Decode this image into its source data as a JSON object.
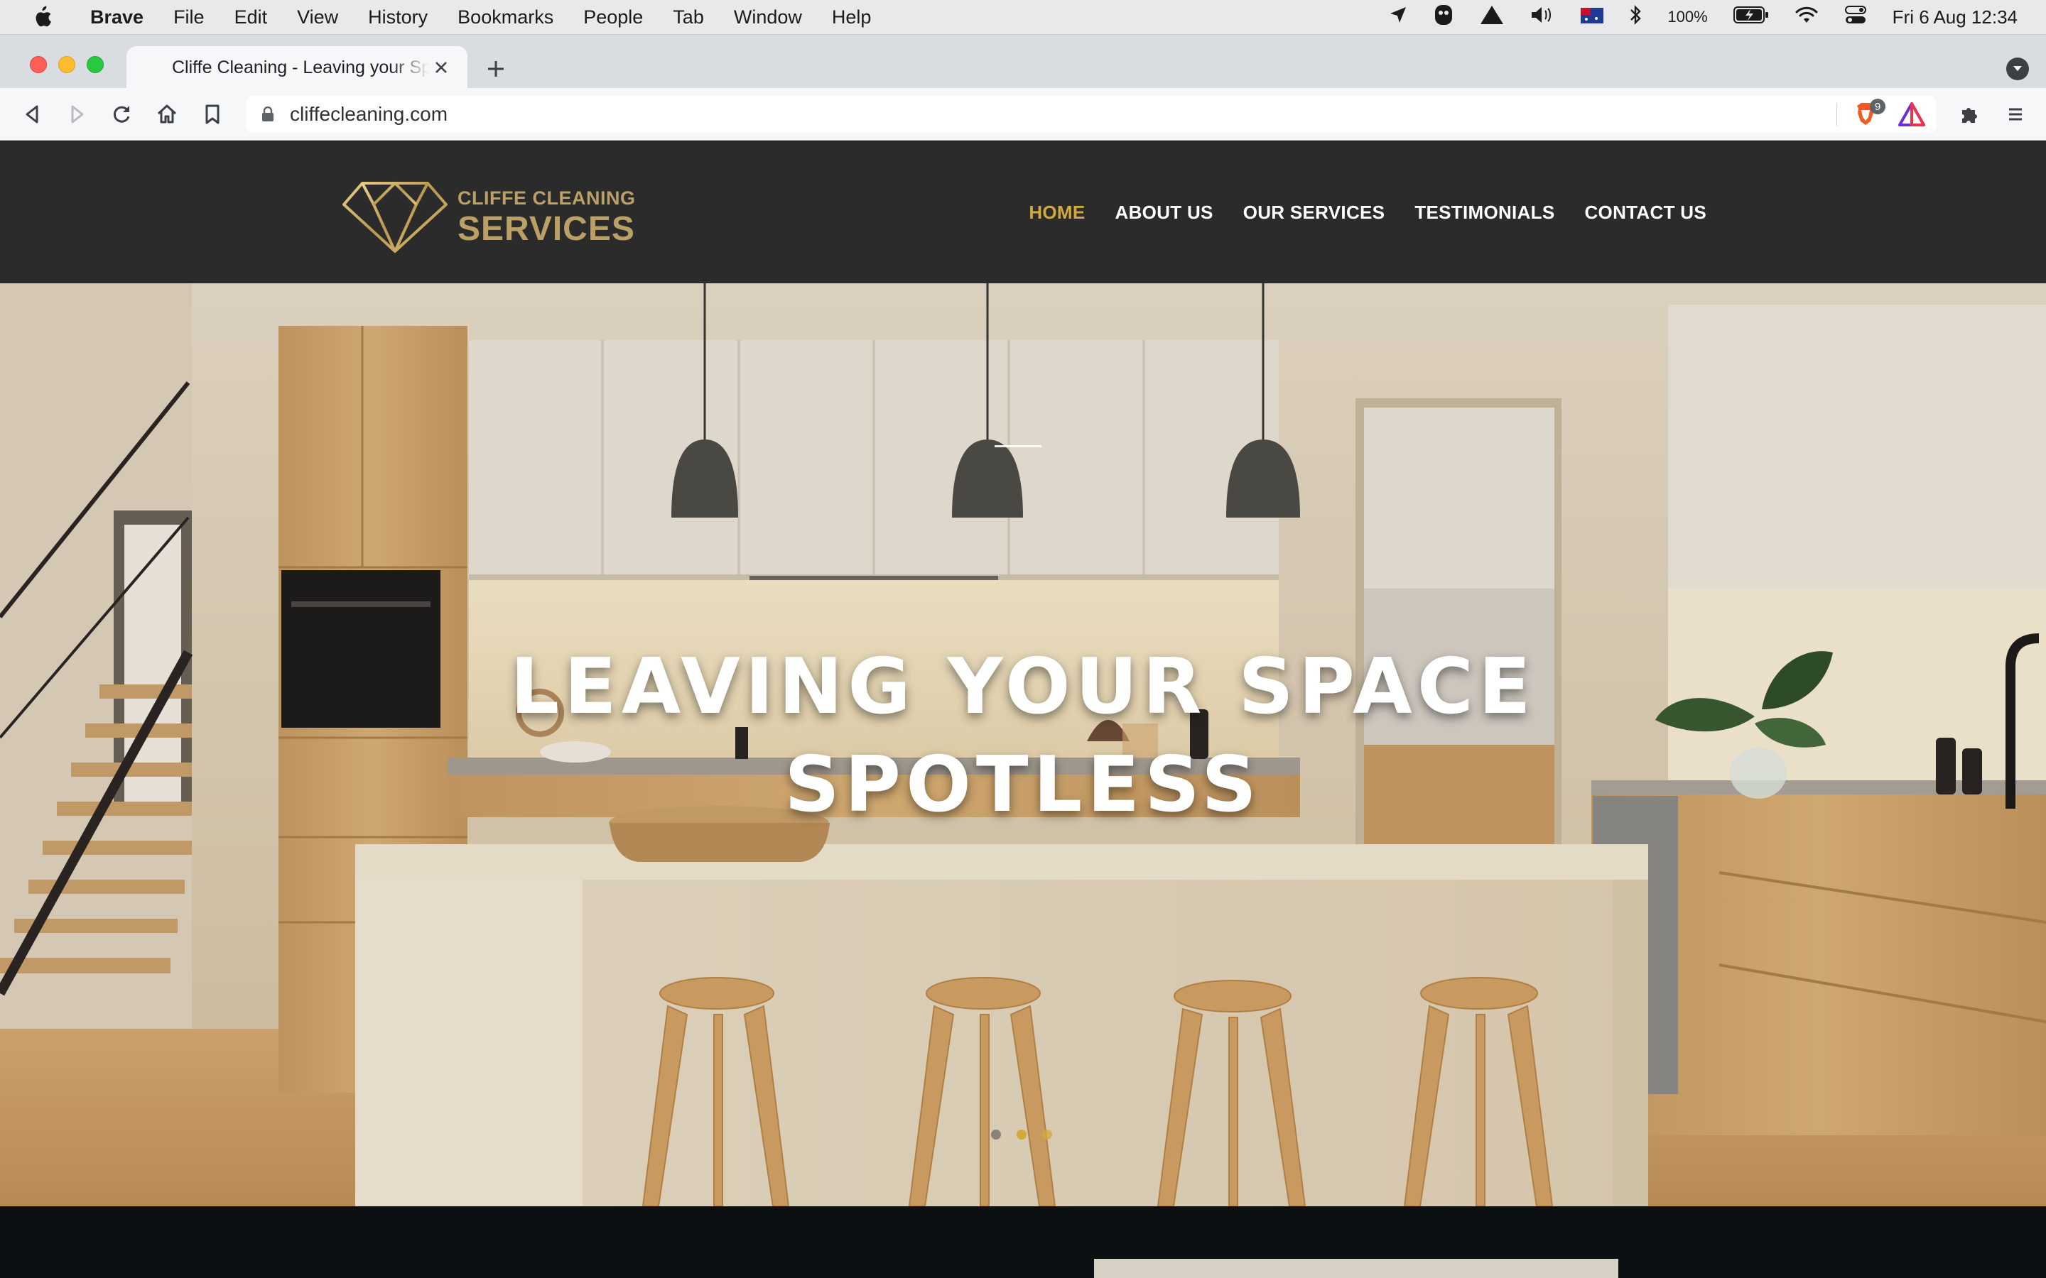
{
  "menubar": {
    "app_name": "Brave",
    "items": [
      "File",
      "Edit",
      "View",
      "History",
      "Bookmarks",
      "People",
      "Tab",
      "Window",
      "Help"
    ],
    "battery": "100%",
    "datetime": "Fri 6 Aug  12:34"
  },
  "browser": {
    "tab_title": "Cliffe Cleaning - Leaving your Space Spotless",
    "url": "cliffecleaning.com",
    "shields_count": "9"
  },
  "site": {
    "logo_line1": "CLIFFE CLEANING",
    "logo_line2": "SERVICES",
    "nav": [
      {
        "label": "HOME",
        "active": true
      },
      {
        "label": "ABOUT US",
        "active": false
      },
      {
        "label": "OUR SERVICES",
        "active": false
      },
      {
        "label": "TESTIMONIALS",
        "active": false
      },
      {
        "label": "CONTACT US",
        "active": false
      }
    ],
    "hero": {
      "headline_line1": "LEAVING YOUR SPACE",
      "headline_line2": "SPOTLESS",
      "slide_count": 3,
      "active_slide": 2
    }
  },
  "colors": {
    "header_bg": "#2b2b2c",
    "gold": "#bba066",
    "nav_active": "#d4a93c"
  }
}
